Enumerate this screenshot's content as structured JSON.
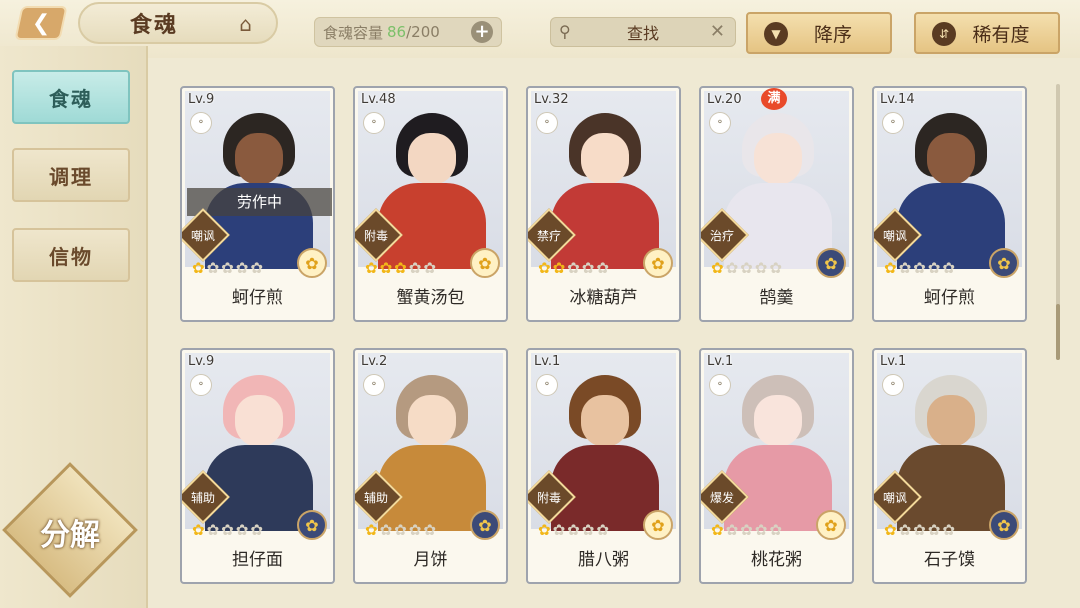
{
  "header": {
    "back_icon": "back-arrow-icon",
    "title": "食魂",
    "home_icon": "pavilion-icon",
    "capacity_label": "食魂容量",
    "capacity_current": "86",
    "capacity_max": "/200",
    "add_icon": "plus-icon",
    "search_placeholder": "查找",
    "sort_label": "降序",
    "rarity_label": "稀有度",
    "accent_green": "#7cc06a"
  },
  "sidebar": {
    "items": [
      {
        "label": "食魂",
        "active": true
      },
      {
        "label": "调理",
        "active": false
      },
      {
        "label": "信物",
        "active": false
      }
    ],
    "decompose_label": "分解"
  },
  "cards": [
    {
      "level": "Lv.9",
      "name": "蚵仔煎",
      "role": "嘲讽",
      "stars": 1,
      "status": "劳作中",
      "full": "",
      "rarity": "gold",
      "hair": "#2c2622",
      "skin": "#8a5a3e",
      "outfit": "#2c3f7a"
    },
    {
      "level": "Lv.48",
      "name": "蟹黄汤包",
      "role": "附毒",
      "stars": 3,
      "status": "",
      "full": "",
      "rarity": "gold",
      "hair": "#1f1c20",
      "skin": "#f3d7c2",
      "outfit": "#c8402e"
    },
    {
      "level": "Lv.32",
      "name": "冰糖葫芦",
      "role": "禁疗",
      "stars": 2,
      "status": "",
      "full": "",
      "rarity": "gold",
      "hair": "#4a3428",
      "skin": "#f7dcc8",
      "outfit": "#c23a36"
    },
    {
      "level": "Lv.20",
      "name": "鹄羹",
      "role": "治疗",
      "stars": 1,
      "status": "",
      "full": "满",
      "rarity": "blue",
      "hair": "#e9e6ea",
      "skin": "#f7e2d6",
      "outfit": "#e8e6ee"
    },
    {
      "level": "Lv.14",
      "name": "蚵仔煎",
      "role": "嘲讽",
      "stars": 1,
      "status": "",
      "full": "",
      "rarity": "blue",
      "hair": "#2c2622",
      "skin": "#8a5a3e",
      "outfit": "#2c3f7a"
    },
    {
      "level": "Lv.9",
      "name": "担仔面",
      "role": "辅助",
      "stars": 1,
      "status": "",
      "full": "",
      "rarity": "blue",
      "hair": "#f1b6b6",
      "skin": "#f9e0d4",
      "outfit": "#2e3a5a"
    },
    {
      "level": "Lv.2",
      "name": "月饼",
      "role": "辅助",
      "stars": 1,
      "status": "",
      "full": "",
      "rarity": "blue",
      "hair": "#b59a80",
      "skin": "#f6dcc6",
      "outfit": "#c78a3a"
    },
    {
      "level": "Lv.1",
      "name": "腊八粥",
      "role": "附毒",
      "stars": 1,
      "status": "",
      "full": "",
      "rarity": "gold",
      "hair": "#7a4a26",
      "skin": "#e8c2a0",
      "outfit": "#7a2a2a"
    },
    {
      "level": "Lv.1",
      "name": "桃花粥",
      "role": "爆发",
      "stars": 1,
      "status": "",
      "full": "",
      "rarity": "gold",
      "hair": "#cdbfb8",
      "skin": "#f9e4dc",
      "outfit": "#e69aa6"
    },
    {
      "level": "Lv.1",
      "name": "石子馍",
      "role": "嘲讽",
      "stars": 1,
      "status": "",
      "full": "",
      "rarity": "blue",
      "hair": "#d9d6cf",
      "skin": "#d9b08a",
      "outfit": "#6a4a2e"
    }
  ]
}
